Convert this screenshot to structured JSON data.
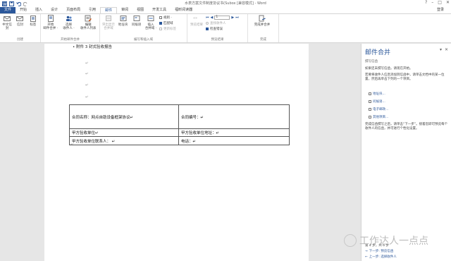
{
  "window": {
    "title": "水表方案文件制度协议书(Subox [兼容模式] - Word",
    "minimize": "–",
    "maximize": "□",
    "close": "✕",
    "help": "?",
    "account": "登录"
  },
  "tabs": [
    "文件",
    "开始",
    "插入",
    "设计",
    "页面布局",
    "引用",
    "邮件",
    "审阅",
    "视图",
    "开发工具",
    "福昕阅读器"
  ],
  "ribbon": {
    "create": {
      "label": "创建",
      "buttons": [
        "中文信封",
        "信封",
        "标签"
      ]
    },
    "start": {
      "label": "开始邮件合并",
      "buttons": [
        "开始\n邮件合并 ·",
        "选择\n收件人 ·",
        "编辑\n收件人列表"
      ]
    },
    "fields": {
      "label": "编写和插入域",
      "buttons": [
        "突出显示\n合并域",
        "地址块",
        "问候语",
        "插入\n合并域 ·"
      ],
      "small": [
        "规则 ·",
        "匹配域",
        "更新标签"
      ]
    },
    "preview": {
      "label": "预览结果",
      "button": "预览结果",
      "record": "1",
      "small": [
        "查找收件人",
        "检查错误"
      ]
    },
    "finish": {
      "label": "完成",
      "button": "完成并合并"
    }
  },
  "document": {
    "top_line": "• 附件 3 封式验收报告",
    "paragraph_mark": "↵",
    "table": [
      [
        "合同名称：网点自助设备框架协议↵",
        "合同编号：↵"
      ],
      [
        "甲方验收单位↵",
        "甲方验收单位地址：↵"
      ],
      [
        "甲方验收单位联系人： ↵",
        "电话：↵"
      ]
    ]
  },
  "pane": {
    "title": "邮件合并",
    "dropdown": "▾",
    "close": "✕",
    "subtitle": "撰写信函",
    "intro1": "如果还未撰写信函，请现在开始。",
    "intro2": "若要将收件人信息添加到信函中，请单击文档中的某一位置，然后再单击下列的一个项目。",
    "links": [
      "地址块...",
      "问候语...",
      "电子邮政...",
      "其他项目..."
    ],
    "outro": "完成信函撰写之后，请单击“下一步”。接着您即可预览每个收件人的信函，并可进行个性化设置。",
    "step": "第 4 步，共 6 步",
    "next": "下一步: 预览信函",
    "prev": "上一步: 选择收件人"
  },
  "watermark": {
    "text": "工作达人一点点"
  },
  "colors": {
    "accent": "#2b579a",
    "ribbon_bg": "#ffffff",
    "doc_bg": "#e6e6e6"
  }
}
